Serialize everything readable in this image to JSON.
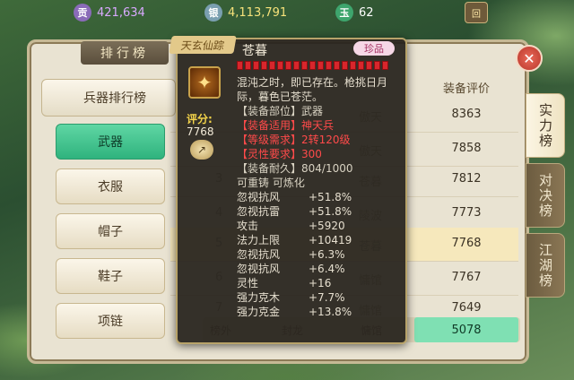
{
  "colors": {
    "accent_green": "#2fb37e",
    "highlight_row": "#f6e8bc",
    "tooltip_red": "#ff4a4a",
    "score_label": "#f4d44a"
  },
  "resources": [
    {
      "icon": "coin-icon",
      "glyph": "贡",
      "value": "421,634",
      "color": "#d9a9ff",
      "bg": "#8a6bb8"
    },
    {
      "icon": "silver-icon",
      "glyph": "银",
      "value": "4,113,791",
      "color": "#f6e27a",
      "bg": "#7a9fb0"
    },
    {
      "icon": "jade-icon",
      "glyph": "玉",
      "value": "62",
      "color": "#ffffff",
      "bg": "#3ea56d"
    }
  ],
  "top_button": "回",
  "panel": {
    "title": "排行榜",
    "category_header": "兵器排行榜",
    "categories": [
      "武器",
      "衣服",
      "帽子",
      "鞋子",
      "项链"
    ],
    "active_category": 0,
    "column_header": "装备评价",
    "rows": [
      {
        "rank": "",
        "name": "傲天",
        "score": "8363"
      },
      {
        "rank": "",
        "name": "傲天",
        "score": "7858"
      },
      {
        "rank": "3",
        "name": "苍暮",
        "score": "7812"
      },
      {
        "rank": "4",
        "name": "陵波",
        "score": "7773"
      },
      {
        "rank": "5",
        "name": "苍暮",
        "score": "7768"
      },
      {
        "rank": "6",
        "name": "慵馆",
        "score": "7767"
      },
      {
        "rank": "7",
        "name": "慵馆",
        "score": "7649"
      }
    ],
    "self_row": {
      "a": "榜外",
      "b": "封龙",
      "c": "慵馆",
      "score": "5078"
    }
  },
  "tabs": [
    "实力榜",
    "对决榜",
    "江湖榜"
  ],
  "active_tab": 0,
  "tooltip": {
    "series": "天玄仙踪",
    "name": "苍暮",
    "rarity": "珍品",
    "stars": 19,
    "item_glyph": "✦",
    "score_label": "评分:",
    "score_value": "7768",
    "share_glyph": "↗",
    "desc1": "混沌之时，即已存在。枪挑日月",
    "desc2": "际，暮色已苍茫。",
    "info": [
      {
        "text": "【装备部位】武器",
        "cls": "gray"
      },
      {
        "text": "【装备适用】神天兵",
        "cls": "red"
      },
      {
        "text": "【等级需求】2转120级",
        "cls": "red"
      },
      {
        "text": "【灵性要求】300",
        "cls": "red"
      },
      {
        "text": "【装备耐久】804/1000",
        "cls": "gray"
      },
      {
        "text": "可重铸 可炼化",
        "cls": "gray"
      }
    ],
    "stats": [
      {
        "k": "忽视抗风",
        "v": "+51.8%"
      },
      {
        "k": "忽视抗雷",
        "v": "+51.8%"
      },
      {
        "k": "攻击",
        "v": "+5920"
      },
      {
        "k": "法力上限",
        "v": "+10419"
      },
      {
        "k": "忽视抗风",
        "v": "+6.3%"
      },
      {
        "k": "忽视抗风",
        "v": "+6.4%"
      },
      {
        "k": "灵性",
        "v": "+16"
      },
      {
        "k": "强力克木",
        "v": "+7.7%"
      },
      {
        "k": "强力克金",
        "v": "+13.8%"
      }
    ]
  }
}
